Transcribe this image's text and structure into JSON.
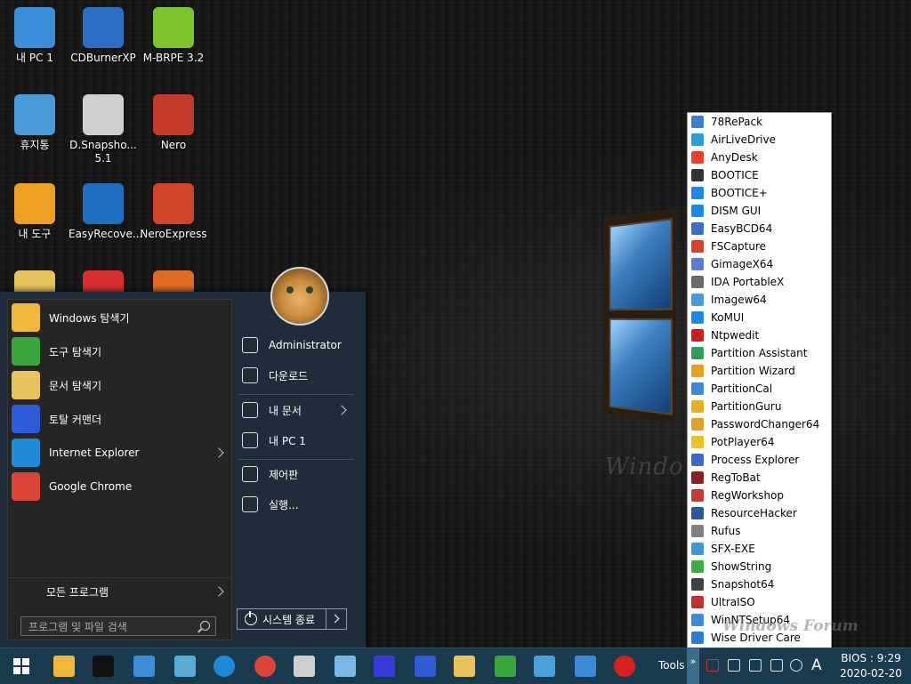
{
  "desktop": {
    "icons": [
      {
        "label": "내 PC 1",
        "icon": "computer-icon",
        "color": "#3a8fd8"
      },
      {
        "label": "CDBurnerXP",
        "icon": "cd-burner-icon",
        "color": "#2b6fc4"
      },
      {
        "label": "M-BRPE 3.2",
        "icon": "drive-icon",
        "color": "#7cc42e"
      },
      {
        "label": "휴지통",
        "icon": "recycle-bin-icon",
        "color": "#4a9ad8"
      },
      {
        "label": "D.Snapsho... 5.1",
        "icon": "snapshot-drive-icon",
        "color": "#cfcfcf"
      },
      {
        "label": "Nero",
        "icon": "nero-icon",
        "color": "#c43b2b"
      },
      {
        "label": "내 도구",
        "icon": "my-tools-icon",
        "color": "#f0a020"
      },
      {
        "label": "EasyRecove...",
        "icon": "easy-recovery-icon",
        "color": "#1e6fc0"
      },
      {
        "label": "NeroExpress",
        "icon": "nero-express-icon",
        "color": "#d0452a"
      },
      {
        "label": "",
        "icon": "folder-icon",
        "color": "#e8c25a"
      },
      {
        "label": "",
        "icon": "app-icon",
        "color": "#d83030"
      },
      {
        "label": "",
        "icon": "app-icon",
        "color": "#e06a20"
      }
    ]
  },
  "start_menu": {
    "pinned": [
      {
        "label": "Windows 탐색기",
        "icon": "folder-explorer-icon",
        "color": "#f0b83a",
        "arrow": false
      },
      {
        "label": "도구 탐색기",
        "icon": "tools-explorer-icon",
        "color": "#3aa53a",
        "arrow": false
      },
      {
        "label": "문서 탐색기",
        "icon": "documents-explorer-icon",
        "color": "#e8c25a",
        "arrow": false
      },
      {
        "label": "토탈 커맨더",
        "icon": "total-commander-icon",
        "color": "#2f5bd6",
        "arrow": false
      },
      {
        "label": "Internet Explorer",
        "icon": "internet-explorer-icon",
        "color": "#1e8ad8",
        "arrow": true
      },
      {
        "label": "Google Chrome",
        "icon": "chrome-icon",
        "color": "#db4437",
        "arrow": false
      }
    ],
    "all_programs": "모든 프로그램",
    "search_placeholder": "프로그램 및 파일 검색",
    "right_items": [
      {
        "label": "Administrator",
        "icon": "user-icon",
        "arrow": false
      },
      {
        "label": "다운로드",
        "icon": "download-icon",
        "arrow": false
      },
      {
        "label": "내 문서",
        "icon": "star-icon",
        "arrow": true
      },
      {
        "label": "내 PC 1",
        "icon": "computer-icon",
        "arrow": false
      },
      {
        "label": "제어판",
        "icon": "wrench-icon",
        "arrow": false
      },
      {
        "label": "실행...",
        "icon": "run-icon",
        "arrow": false
      }
    ],
    "shutdown_label": "시스템 종료"
  },
  "tools_menu": {
    "items": [
      {
        "label": "78RePack",
        "color": "#3a7fd0"
      },
      {
        "label": "AirLiveDrive",
        "color": "#2aa0d8"
      },
      {
        "label": "AnyDesk",
        "color": "#e8402a"
      },
      {
        "label": "BOOTICE",
        "color": "#333333"
      },
      {
        "label": "BOOTICE+",
        "color": "#1e88e5"
      },
      {
        "label": "DISM GUI",
        "color": "#1e88e5"
      },
      {
        "label": "EasyBCD64",
        "color": "#3b6fc8"
      },
      {
        "label": "FSCapture",
        "color": "#d8402a"
      },
      {
        "label": "GimageX64",
        "color": "#5a7ad8"
      },
      {
        "label": "IDA PortableX",
        "color": "#6a6a6a"
      },
      {
        "label": "Imagew64",
        "color": "#4a9ad8"
      },
      {
        "label": "KoMUI",
        "color": "#1e88e5"
      },
      {
        "label": "Ntpwedit",
        "color": "#c81e1e"
      },
      {
        "label": "Partition Assistant",
        "color": "#2aa05a"
      },
      {
        "label": "Partition Wizard",
        "color": "#e8a020"
      },
      {
        "label": "PartitionCal",
        "color": "#3a8ad8"
      },
      {
        "label": "PartitionGuru",
        "color": "#e8b020"
      },
      {
        "label": "PasswordChanger64",
        "color": "#e0a030"
      },
      {
        "label": "PotPlayer64",
        "color": "#f0c020"
      },
      {
        "label": "Process Explorer",
        "color": "#3a6ac8"
      },
      {
        "label": "RegToBat",
        "color": "#8a2020"
      },
      {
        "label": "RegWorkshop",
        "color": "#c83a3a"
      },
      {
        "label": "ResourceHacker",
        "color": "#2a5a9a"
      },
      {
        "label": "Rufus",
        "color": "#808080"
      },
      {
        "label": "SFX-EXE",
        "color": "#3a9ad8"
      },
      {
        "label": "ShowString",
        "color": "#3ab03a"
      },
      {
        "label": "Snapshot64",
        "color": "#404040"
      },
      {
        "label": "UltraISO",
        "color": "#c03030"
      },
      {
        "label": "WinNTSetup64",
        "color": "#3a8ad8"
      },
      {
        "label": "Wise Driver Care",
        "color": "#2a7ad8"
      }
    ]
  },
  "watermark": "Windows Forum",
  "taskbar": {
    "pinned_icons": [
      {
        "icon": "file-explorer-icon",
        "color": "#f0b83a"
      },
      {
        "icon": "command-prompt-icon",
        "color": "#111111"
      },
      {
        "icon": "computer-icon",
        "color": "#3a8fd8"
      },
      {
        "icon": "task-manager-icon",
        "color": "#5aaad8"
      },
      {
        "icon": "internet-explorer-icon",
        "color": "#1e8ad8"
      },
      {
        "icon": "chrome-icon",
        "color": "#db4437"
      },
      {
        "icon": "drive-icon",
        "color": "#cfcfcf"
      },
      {
        "icon": "notepad-icon",
        "color": "#7ab8e8"
      },
      {
        "icon": "qr-tool-icon",
        "color": "#3a3ad8"
      },
      {
        "icon": "floppy-save-icon",
        "color": "#2f5bd6"
      },
      {
        "icon": "documents-explorer-icon",
        "color": "#e8c25a"
      },
      {
        "icon": "tools-explorer-icon",
        "color": "#3aa53a"
      },
      {
        "icon": "network-icon",
        "color": "#4aa0d8"
      },
      {
        "icon": "display-icon",
        "color": "#3a8ad8"
      },
      {
        "icon": "power-icon",
        "color": "#d82020"
      }
    ],
    "tools_label": "Tools",
    "tray_chevron": "»",
    "ime": "A",
    "clock_top": "BIOS : 9:29",
    "clock_date": "2020-02-20"
  }
}
